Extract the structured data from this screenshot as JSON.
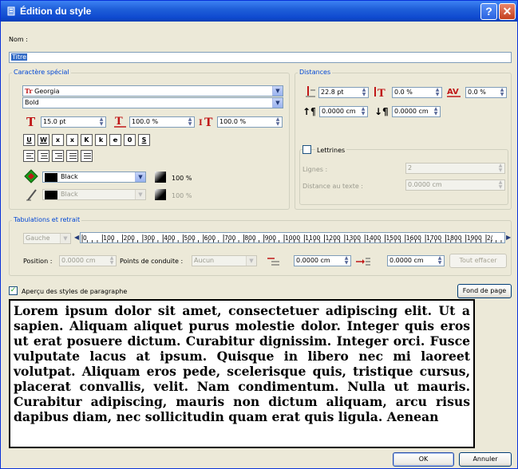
{
  "window": {
    "title": "Édition du style",
    "help_label": "?",
    "close_label": "✕"
  },
  "name": {
    "label": "Nom :",
    "value": "Titre"
  },
  "special_chars": {
    "title": "Caractère spécial",
    "font": "Georgia",
    "style": "Bold",
    "size": "15.0 pt",
    "scale_h": "100.0 %",
    "scale_v": "100.0 %",
    "effects": [
      "U",
      "W",
      "x",
      "x",
      "K",
      "k",
      "e",
      "0",
      "S"
    ],
    "fill_color": "Black",
    "fill_opacity": "100 %",
    "stroke_color": "Black",
    "stroke_opacity": "100 %"
  },
  "distances": {
    "title": "Distances",
    "line_spacing": "22.8 pt",
    "baseline_offset": "0.0 %",
    "tracking": "0.0 %",
    "space_above": "0.0000 cm",
    "space_below": "0.0000 cm"
  },
  "dropcaps": {
    "label": "Lettrines",
    "checked": false,
    "lines_label": "Lignes :",
    "lines_value": "2",
    "distance_label": "Distance au texte :",
    "distance_value": "0.0000 cm"
  },
  "tabs": {
    "title": "Tabulations et retrait",
    "alignment": "Gauche",
    "ruler_labels": [
      "0",
      "100",
      "200",
      "300",
      "400",
      "500",
      "600",
      "700",
      "800",
      "900",
      "1000",
      "1100",
      "1200",
      "1300",
      "1400",
      "1500",
      "1600",
      "1700",
      "1800",
      "1900",
      "2("
    ],
    "position_label": "Position :",
    "position_value": "0.0000 cm",
    "leader_label": "Points de conduite :",
    "leader_value": "Aucun",
    "first_indent": "0.0000 cm",
    "left_indent": "0.0000 cm",
    "clear_label": "Tout effacer"
  },
  "preview": {
    "checkbox_label": "Aperçu des styles de paragraphe",
    "checked": true,
    "background_button": "Fond de page",
    "text": "Lorem ipsum dolor sit amet, consectetuer adipiscing elit. Ut a sapien. Aliquam aliquet purus molestie dolor. Integer quis eros ut erat posuere dictum. Curabitur dignissim. Integer orci. Fusce vulputate lacus at ipsum. Quisque in libero nec mi laoreet volutpat. Aliquam eros pede, scelerisque quis, tristique cursus, placerat convallis, velit. Nam condimentum. Nulla ut mauris. Curabitur adipiscing, mauris non dictum aliquam, arcu risus dapibus diam, nec sollicitudin quam erat quis ligula. Aenean"
  },
  "buttons": {
    "ok": "OK",
    "cancel": "Annuler"
  },
  "colors": {
    "title_bar": "#0f4ad0",
    "group_title": "#0046d5",
    "fill_icon": "#1a9a1a"
  }
}
